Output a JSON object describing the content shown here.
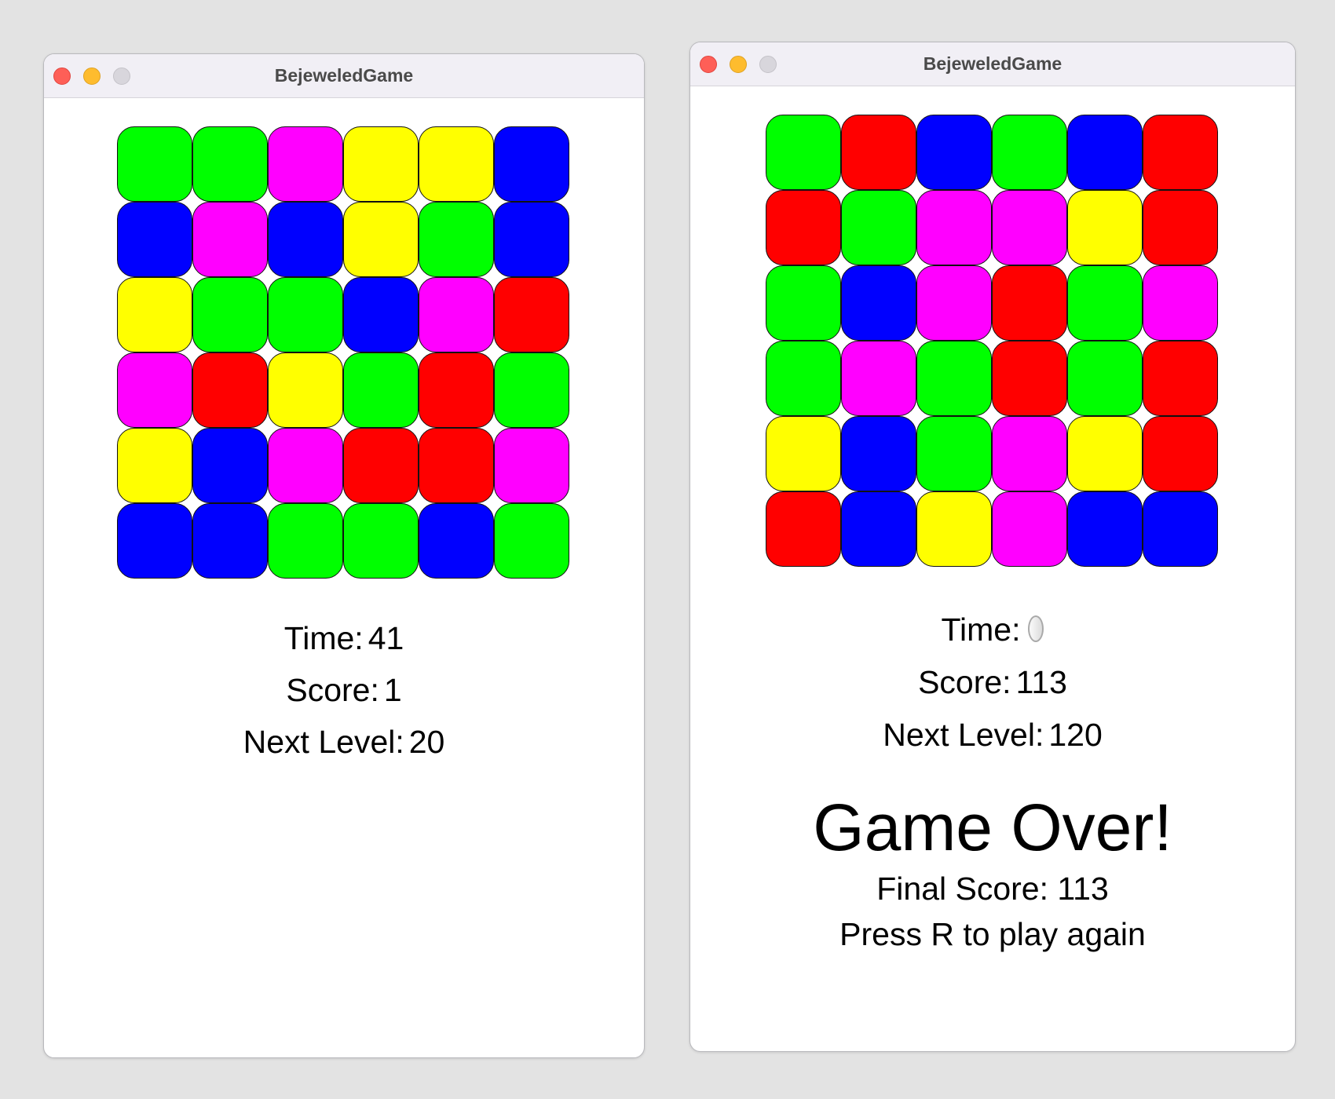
{
  "windows": [
    {
      "title": "BejeweledGame",
      "board": [
        [
          "green",
          "green",
          "magenta",
          "yellow",
          "yellow",
          "blue"
        ],
        [
          "blue",
          "magenta",
          "blue",
          "yellow",
          "green",
          "blue"
        ],
        [
          "yellow",
          "green",
          "green",
          "blue",
          "magenta",
          "red"
        ],
        [
          "magenta",
          "red",
          "yellow",
          "green",
          "red",
          "green"
        ],
        [
          "yellow",
          "blue",
          "magenta",
          "red",
          "red",
          "magenta"
        ],
        [
          "blue",
          "blue",
          "green",
          "green",
          "blue",
          "green"
        ]
      ],
      "time_label": "Time:",
      "time_value": "41",
      "score_label": "Score:",
      "score_value": "1",
      "next_level_label": "Next Level:",
      "next_level_value": "20"
    },
    {
      "title": "BejeweledGame",
      "board": [
        [
          "green",
          "red",
          "blue",
          "green",
          "blue",
          "red"
        ],
        [
          "red",
          "green",
          "magenta",
          "magenta",
          "yellow",
          "red"
        ],
        [
          "green",
          "blue",
          "magenta",
          "red",
          "green",
          "magenta"
        ],
        [
          "green",
          "magenta",
          "green",
          "red",
          "green",
          "red"
        ],
        [
          "yellow",
          "blue",
          "green",
          "magenta",
          "yellow",
          "red"
        ],
        [
          "red",
          "blue",
          "yellow",
          "magenta",
          "blue",
          "blue"
        ]
      ],
      "time_label": "Time:",
      "score_label": "Score:",
      "score_value": "113",
      "next_level_label": "Next Level:",
      "next_level_value": "120",
      "game_over": "Game Over!",
      "final_score": "Final Score: 113",
      "restart_hint": "Press R to play again"
    }
  ],
  "gem_colors": {
    "green": "#00ff00",
    "red": "#ff0000",
    "blue": "#0000ff",
    "yellow": "#ffff00",
    "magenta": "#ff00ff"
  }
}
